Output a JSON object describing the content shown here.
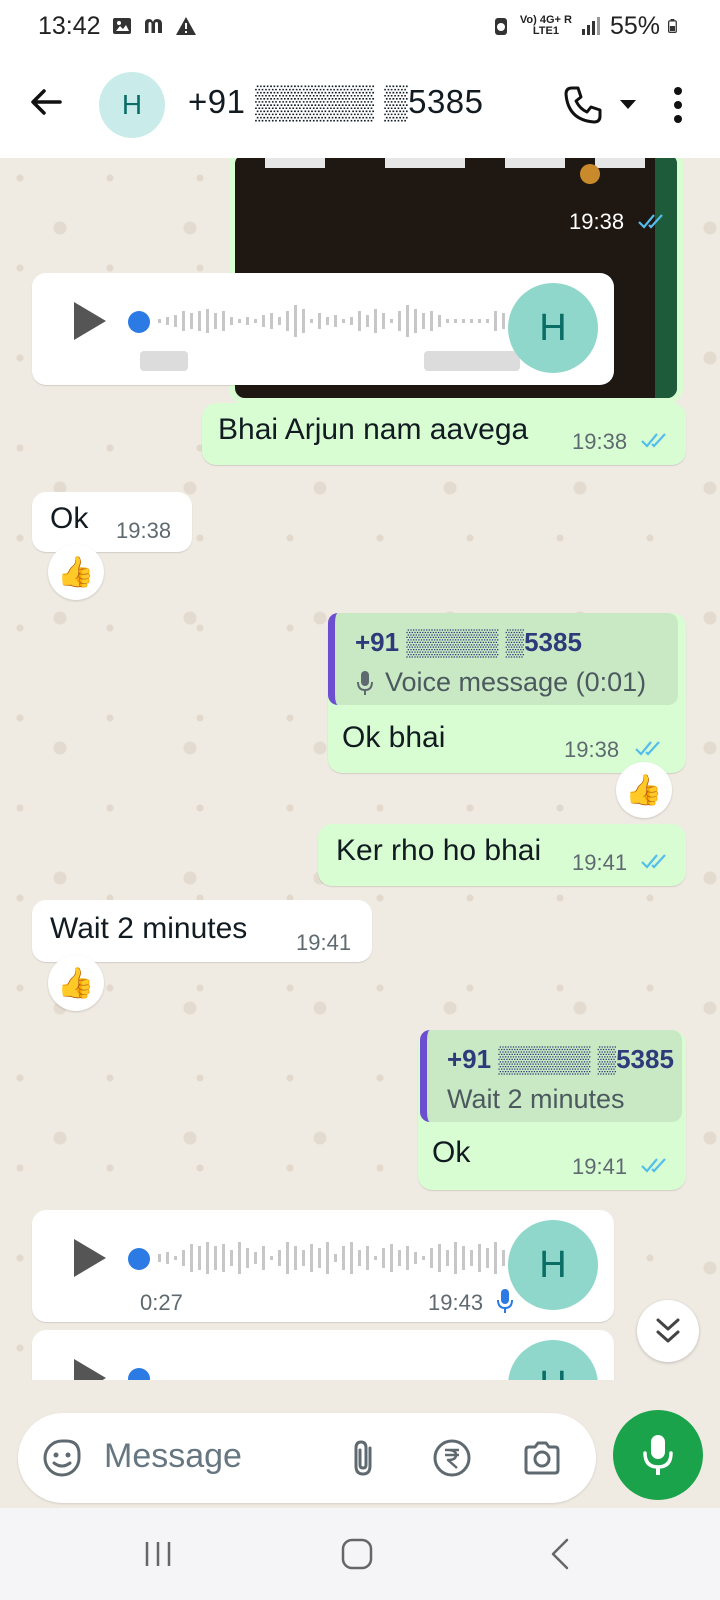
{
  "status_bar": {
    "time": "13:42",
    "network_top": "Vo) 4G+ R",
    "network_bottom": "LTE1",
    "battery": "55%"
  },
  "header": {
    "avatar_letter": "H",
    "contact_name": "+91 ▒▒▒▒▒ ▒5385"
  },
  "messages": [
    {
      "kind": "media",
      "time": "19:38"
    },
    {
      "kind": "voice-in",
      "avatar": "H"
    },
    {
      "kind": "text-out",
      "text": "Bhai Arjun nam aavega",
      "time": "19:38"
    },
    {
      "kind": "text-in",
      "text": "Ok",
      "time": "19:38",
      "reaction": "👍"
    },
    {
      "kind": "reply-out",
      "quote_name": "+91 ▒▒▒▒▒ ▒5385",
      "quote_text": "Voice message (0:01)",
      "text": "Ok bhai",
      "time": "19:38",
      "reaction": "👍"
    },
    {
      "kind": "text-out",
      "text": "Ker rho ho bhai",
      "time": "19:41"
    },
    {
      "kind": "text-in",
      "text": "Wait 2 minutes",
      "time": "19:41",
      "reaction": "👍"
    },
    {
      "kind": "reply-out",
      "quote_name": "+91 ▒▒▒▒▒ ▒5385",
      "quote_text": "Wait 2 minutes",
      "text": "Ok",
      "time": "19:41"
    },
    {
      "kind": "voice-in",
      "avatar": "H",
      "duration": "0:27",
      "time": "19:43"
    },
    {
      "kind": "voice-in-partial",
      "avatar": "H"
    }
  ],
  "input": {
    "placeholder": "Message"
  },
  "colors": {
    "outgoing_bubble": "#d9fdd3",
    "incoming_bubble": "#ffffff",
    "chat_bg": "#efeae2",
    "accent_green": "#1aa34a",
    "tick_blue": "#53bdeb"
  },
  "icons": [
    "back-arrow-icon",
    "phone-icon",
    "chevron-down-icon",
    "more-vert-icon",
    "play-icon",
    "mic-icon",
    "sticker-icon",
    "attach-icon",
    "rupee-icon",
    "camera-icon",
    "double-chevron-down-icon"
  ]
}
